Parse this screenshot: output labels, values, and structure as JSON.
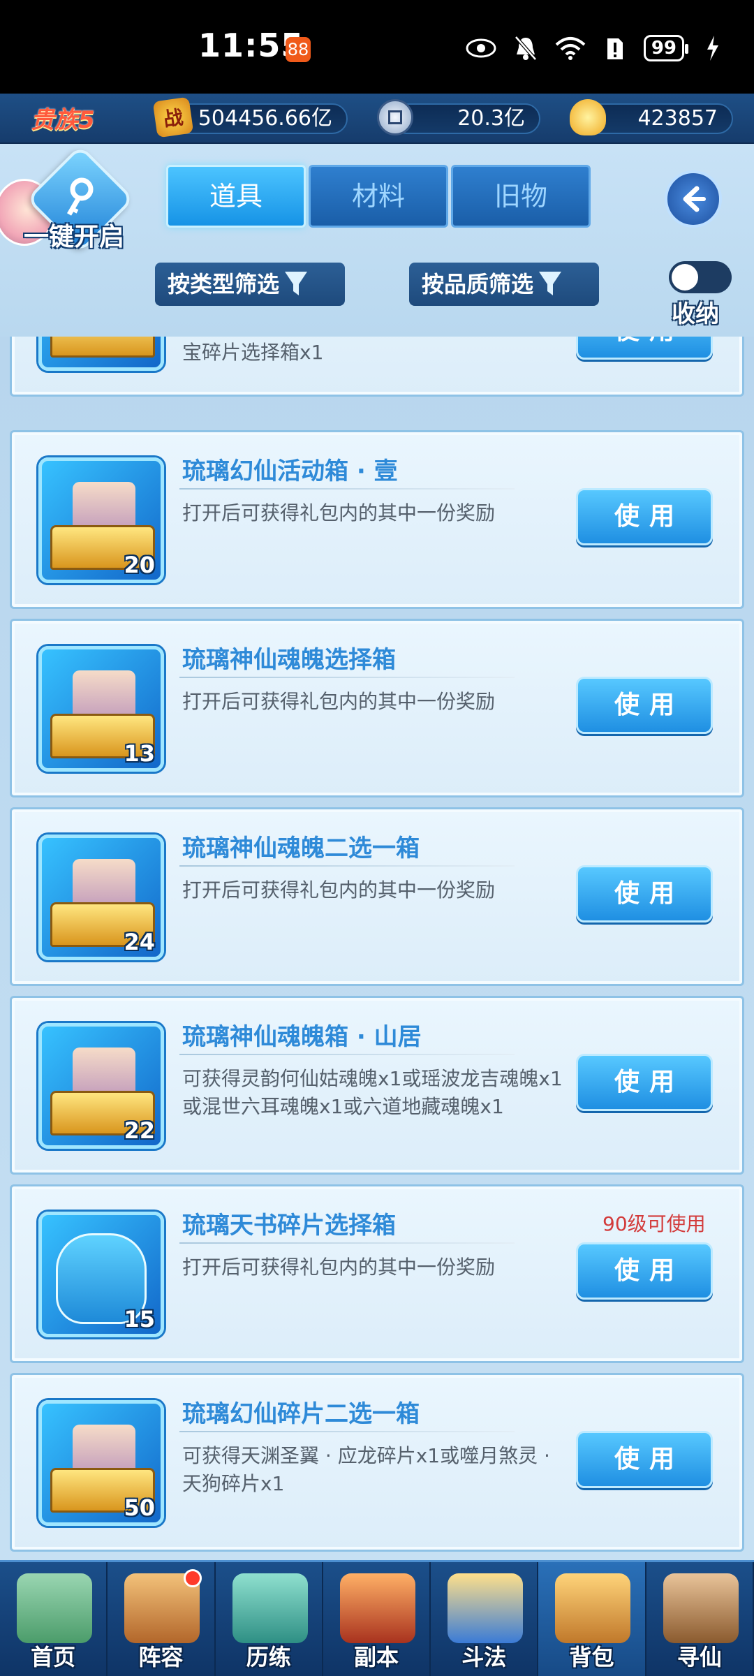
{
  "status_bar": {
    "time": "11:55",
    "app_badge": "88",
    "battery": "99"
  },
  "resources": {
    "vip_label": "贵族5",
    "power_icon": "战",
    "power_value": "504456.66亿",
    "coin_value": "20.3亿",
    "gold_value": "423857"
  },
  "header": {
    "one_key_open": "一键开启",
    "tabs": [
      {
        "label": "道具",
        "active": true
      },
      {
        "label": "材料",
        "active": false
      },
      {
        "label": "旧物",
        "active": false
      }
    ],
    "filter_type": "按类型筛选",
    "filter_quality": "按品质筛选",
    "collect_label": "收纳"
  },
  "items": [
    {
      "name": "",
      "desc": "宝碎片选择箱x1",
      "count": "",
      "level_req": "",
      "button": "使用"
    },
    {
      "name": "琉璃幻仙活动箱 · 壹",
      "desc": "打开后可获得礼包内的其中一份奖励",
      "count": "20",
      "level_req": "",
      "button": "使用"
    },
    {
      "name": "琉璃神仙魂魄选择箱",
      "desc": "打开后可获得礼包内的其中一份奖励",
      "count": "13",
      "level_req": "",
      "button": "使用"
    },
    {
      "name": "琉璃神仙魂魄二选一箱",
      "desc": "打开后可获得礼包内的其中一份奖励",
      "count": "24",
      "level_req": "",
      "button": "使用"
    },
    {
      "name": "琉璃神仙魂魄箱 · 山居",
      "desc": "可获得灵韵何仙姑魂魄x1或瑶波龙吉魂魄x1或混世六耳魂魄x1或六道地藏魂魄x1",
      "count": "22",
      "level_req": "",
      "button": "使用"
    },
    {
      "name": "琉璃天书碎片选择箱",
      "desc": "打开后可获得礼包内的其中一份奖励",
      "count": "15",
      "level_req": "90级可使用",
      "button": "使用"
    },
    {
      "name": "琉璃幻仙碎片二选一箱",
      "desc": "可获得天渊圣翼 · 应龙碎片x1或噬月煞灵 · 天狗碎片x1",
      "count": "50",
      "level_req": "",
      "button": "使用"
    }
  ],
  "nav": [
    {
      "label": "首页",
      "icon": "home-icon",
      "active": false,
      "dot": false
    },
    {
      "label": "阵容",
      "icon": "lineup-icon",
      "active": false,
      "dot": true
    },
    {
      "label": "历练",
      "icon": "training-icon",
      "active": false,
      "dot": false
    },
    {
      "label": "副本",
      "icon": "dungeon-icon",
      "active": false,
      "dot": false
    },
    {
      "label": "斗法",
      "icon": "battle-icon",
      "active": false,
      "dot": false
    },
    {
      "label": "背包",
      "icon": "bag-icon",
      "active": true,
      "dot": false
    },
    {
      "label": "寻仙",
      "icon": "seek-icon",
      "active": false,
      "dot": false
    }
  ],
  "colors": {
    "accent": "#2e8ad8",
    "button": "#1f8fe2",
    "warning": "#d33b3b"
  }
}
